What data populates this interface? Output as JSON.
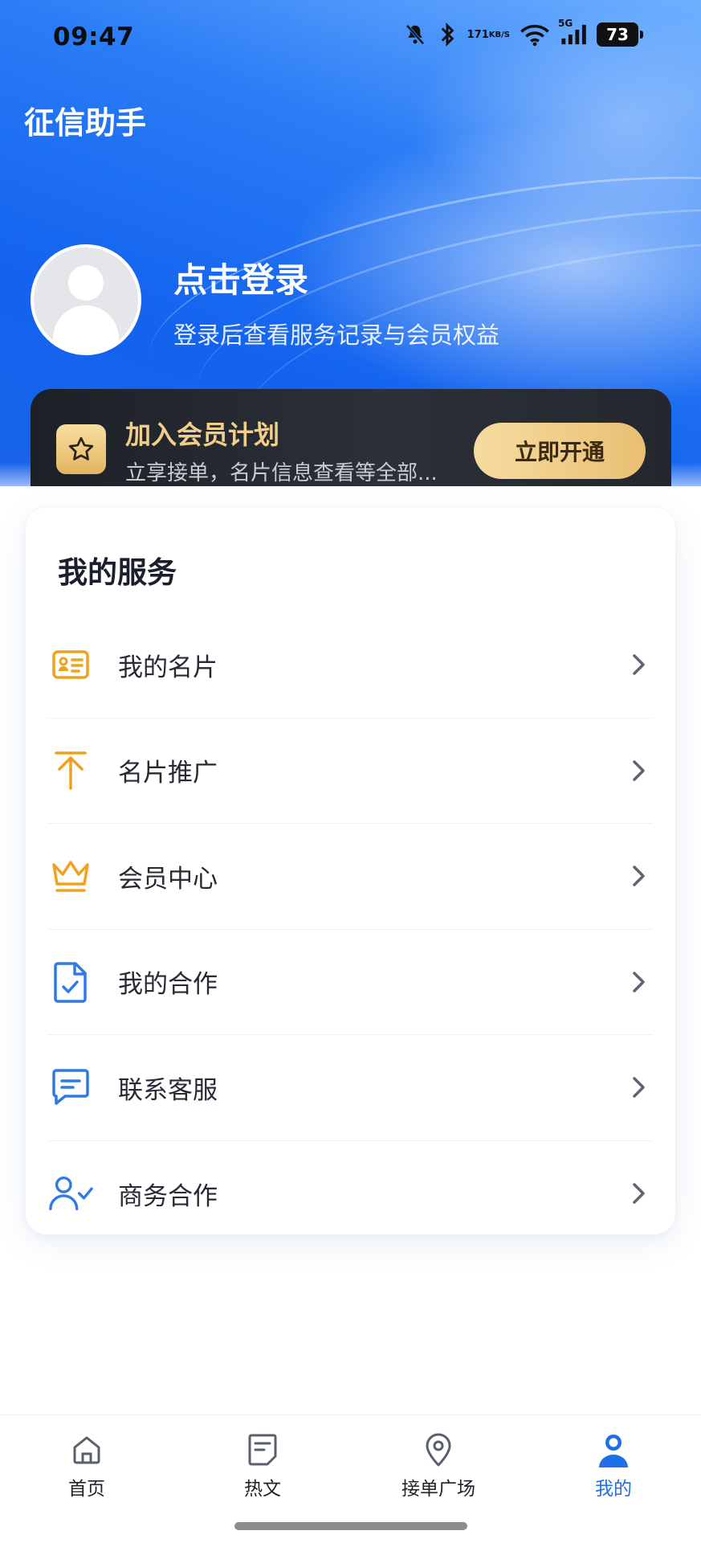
{
  "status_bar": {
    "time": "09:47",
    "net_speed_value": "171",
    "net_speed_unit": "KB/S",
    "signal_label": "5G",
    "battery": "73"
  },
  "header": {
    "app_title": "征信助手"
  },
  "profile": {
    "login_title": "点击登录",
    "login_subtitle": "登录后查看服务记录与会员权益"
  },
  "membership": {
    "title": "加入会员计划",
    "description": "立享接单，名片信息查看等全部...",
    "button_label": "立即开通"
  },
  "services": {
    "title": "我的服务",
    "items": [
      {
        "label": "我的名片",
        "icon": "business-card-icon",
        "color": "#f0a21f"
      },
      {
        "label": "名片推广",
        "icon": "arrow-up-promote-icon",
        "color": "#f0a21f"
      },
      {
        "label": "会员中心",
        "icon": "crown-icon",
        "color": "#f0a21f"
      },
      {
        "label": "我的合作",
        "icon": "document-check-icon",
        "color": "#2e7be6"
      },
      {
        "label": "联系客服",
        "icon": "chat-message-icon",
        "color": "#2e7be6"
      },
      {
        "label": "商务合作",
        "icon": "user-check-icon",
        "color": "#2e7be6"
      }
    ]
  },
  "bottom_nav": {
    "items": [
      {
        "label": "首页",
        "icon": "home-icon",
        "active": false
      },
      {
        "label": "热文",
        "icon": "article-icon",
        "active": false
      },
      {
        "label": "接单广场",
        "icon": "location-pin-icon",
        "active": false
      },
      {
        "label": "我的",
        "icon": "profile-icon",
        "active": true
      }
    ]
  },
  "colors": {
    "brand_blue": "#1d6fe8",
    "gold": "#f1cf8b",
    "service_orange": "#f0a21f"
  }
}
